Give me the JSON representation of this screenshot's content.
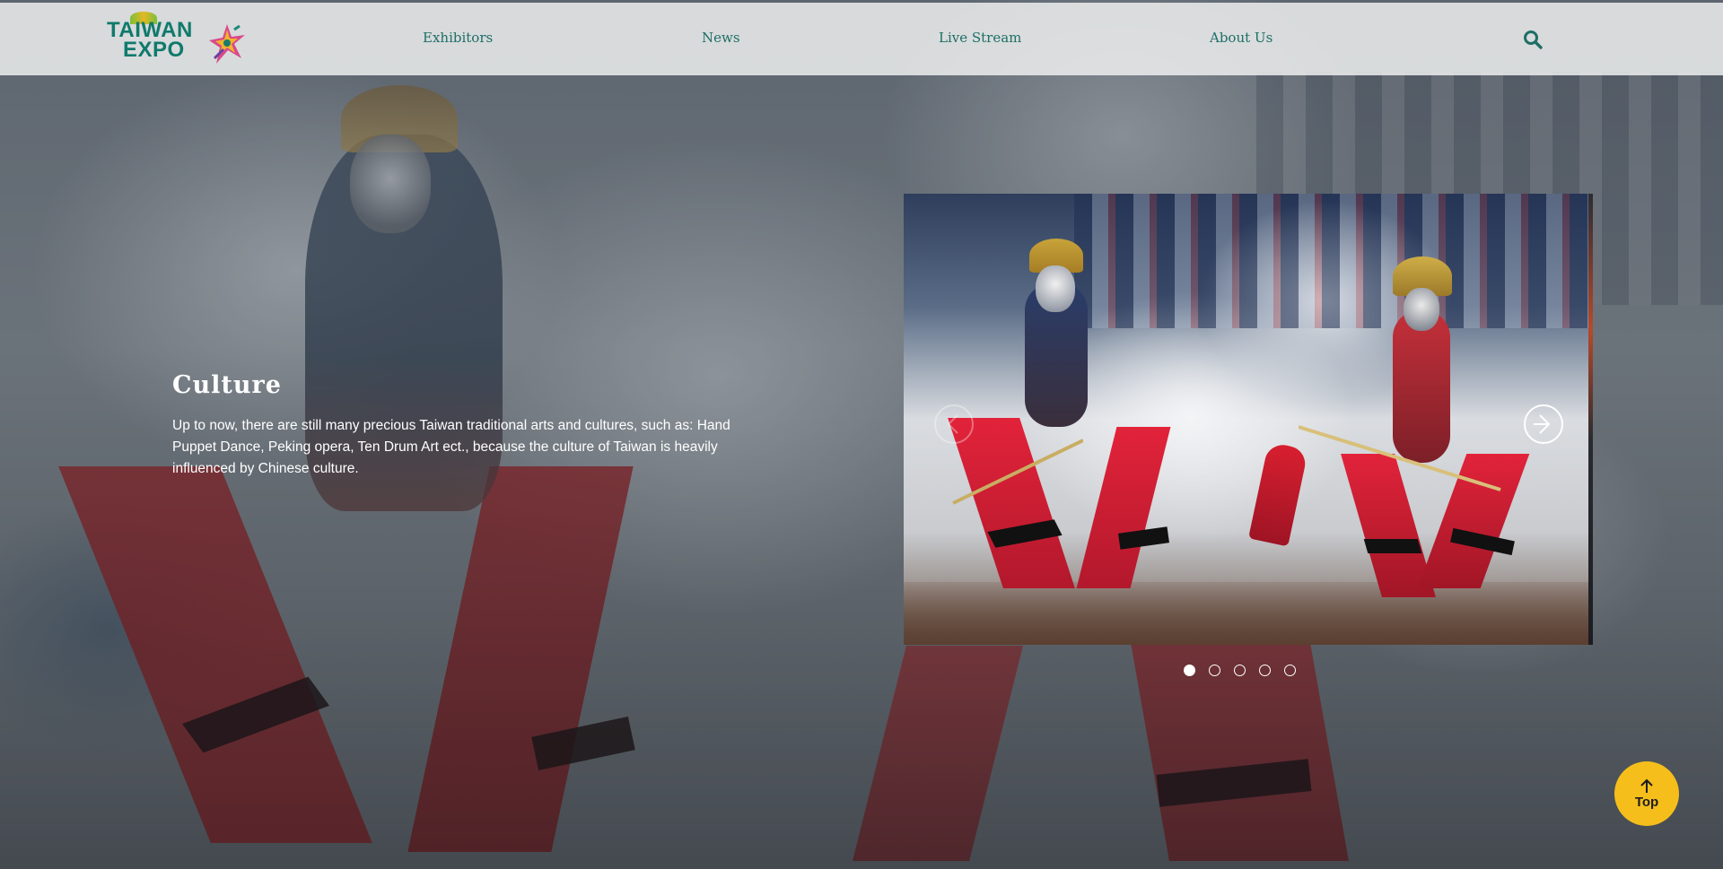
{
  "header": {
    "logo": {
      "line1": "TAIWAN",
      "line2": "EXPO"
    },
    "nav": [
      "Exhibitors",
      "News",
      "Live Stream",
      "About Us"
    ],
    "search_icon": "search-icon"
  },
  "hero": {
    "title": "Culture",
    "description": "Up to now, there are still many precious Taiwan traditional arts and cultures, such as: Hand Puppet Dance, Peking opera, Ten Drum Art ect., because the culture of Taiwan is heavily influenced by Chinese culture."
  },
  "carousel": {
    "slide_count": 5,
    "active_index": 0,
    "next_icon": "arrow-right-circle-icon",
    "prev_icon": "arrow-left-circle-icon"
  },
  "top_button": {
    "label": "Top",
    "icon": "arrow-up-icon"
  },
  "colors": {
    "brand_teal": "#1e6f66",
    "top_button": "#f5be1b",
    "header_bg": "#eceeee"
  }
}
